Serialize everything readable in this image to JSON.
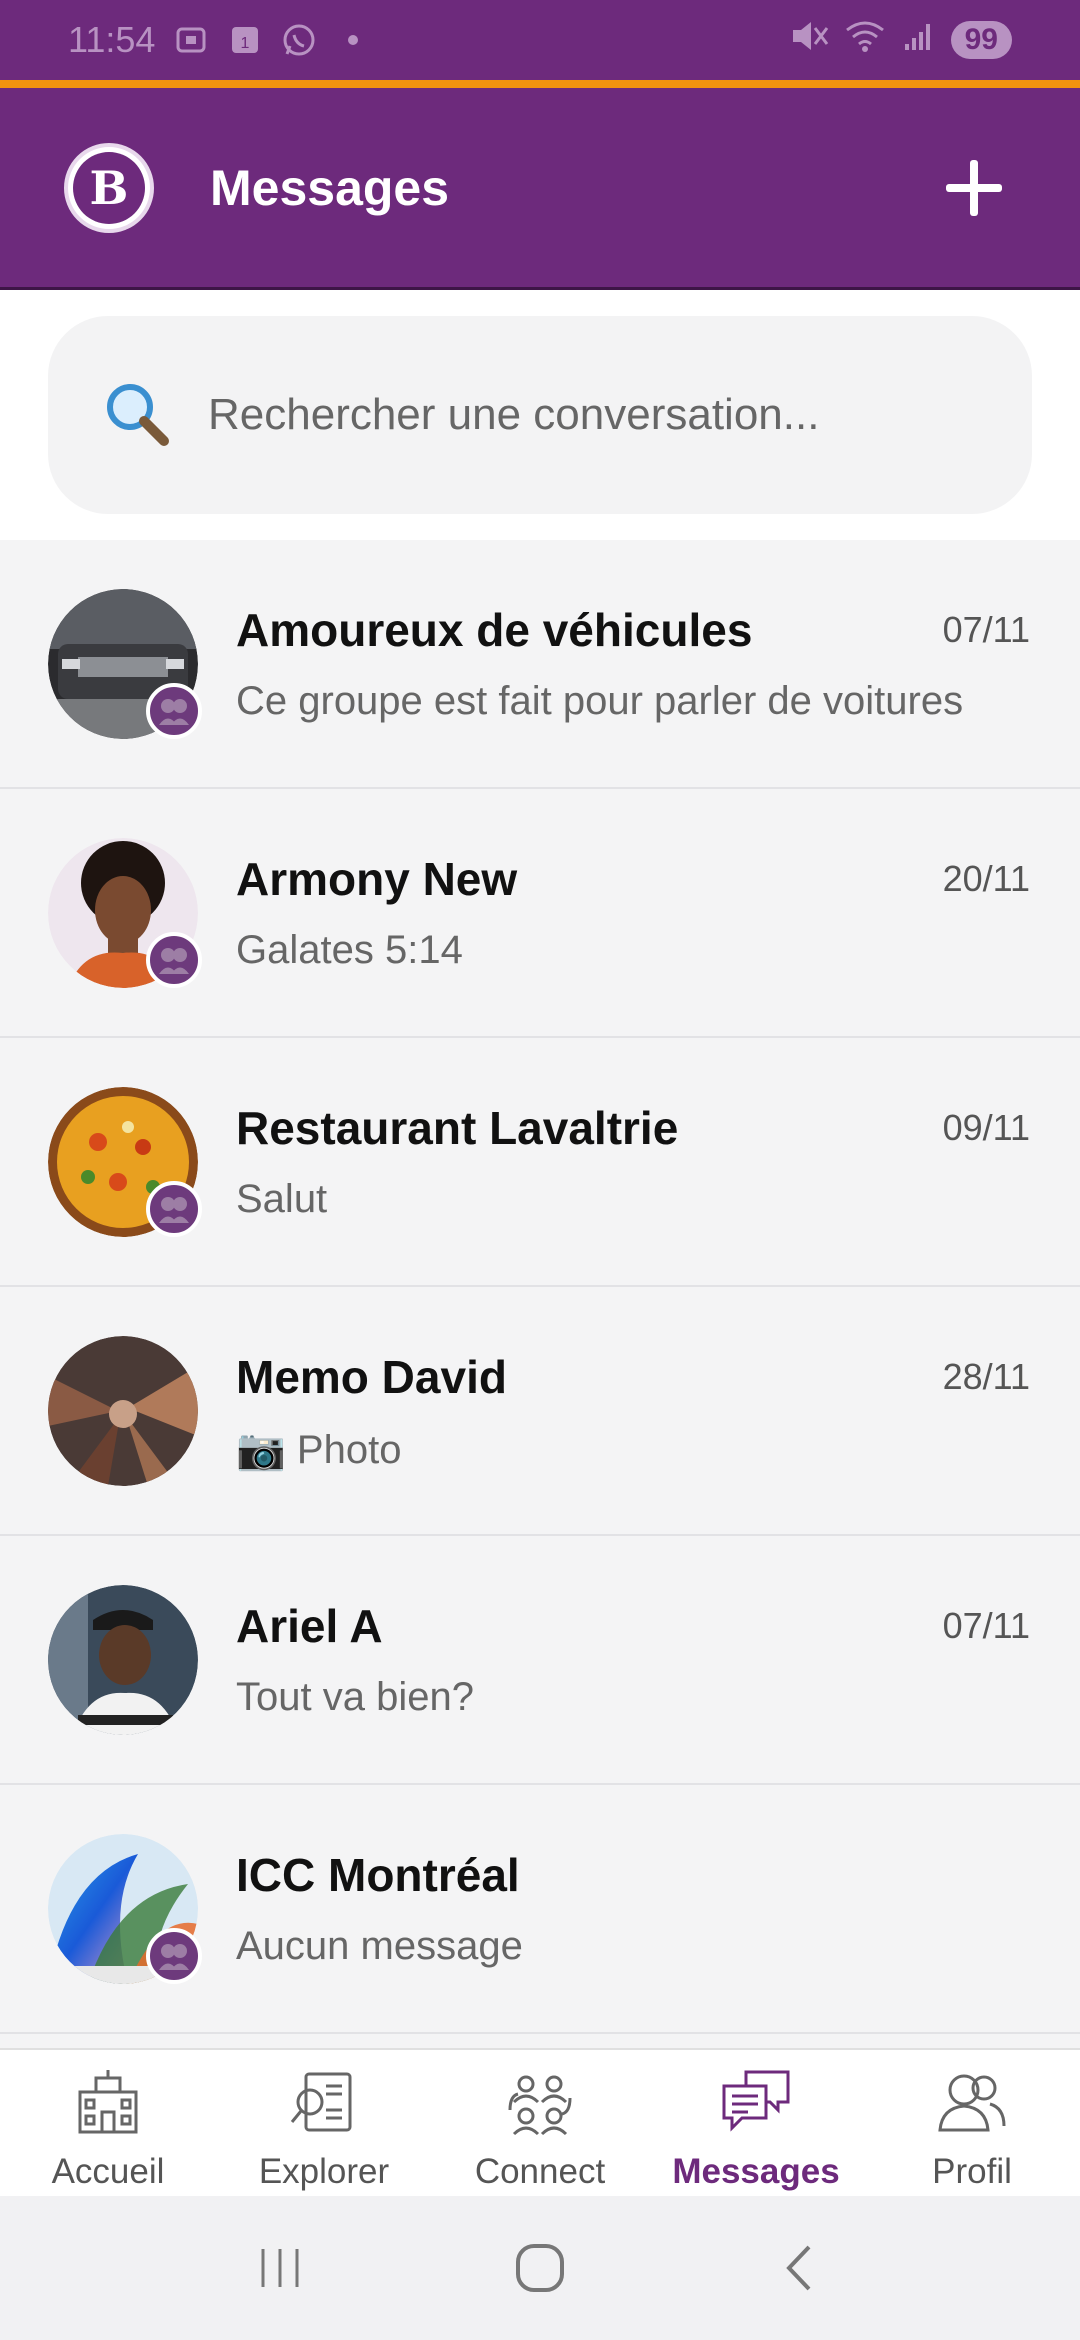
{
  "status_bar": {
    "time": "11:54",
    "battery": "99",
    "notif_badge": "1"
  },
  "header": {
    "title": "Messages",
    "logo_letter": "B"
  },
  "search": {
    "placeholder": "Rechercher une conversation..."
  },
  "conversations": [
    {
      "name": "Amoureux de véhicules",
      "date": "07/11",
      "last_message": "Ce groupe est fait pour parler de voitures",
      "is_group": true
    },
    {
      "name": "Armony New",
      "date": "20/11",
      "last_message": "Galates 5:14",
      "is_group": true
    },
    {
      "name": "Restaurant Lavaltrie",
      "date": "09/11",
      "last_message": "Salut",
      "is_group": true
    },
    {
      "name": "Memo David",
      "date": "28/11",
      "last_message": "📷 Photo",
      "is_group": false
    },
    {
      "name": "Ariel A",
      "date": "07/11",
      "last_message": "Tout va bien?",
      "is_group": false
    },
    {
      "name": "ICC Montréal",
      "date": "",
      "last_message": "Aucun message",
      "is_group": true
    }
  ],
  "bottom_nav": [
    {
      "label": "Accueil",
      "icon": "home-building-icon",
      "active": false
    },
    {
      "label": "Explorer",
      "icon": "explore-document-icon",
      "active": false
    },
    {
      "label": "Connect",
      "icon": "connect-people-icon",
      "active": false
    },
    {
      "label": "Messages",
      "icon": "chat-bubbles-icon",
      "active": true
    },
    {
      "label": "Profil",
      "icon": "profile-icon",
      "active": false
    }
  ],
  "colors": {
    "brand_purple": "#6d2a7c",
    "accent_orange": "#f2920f"
  }
}
